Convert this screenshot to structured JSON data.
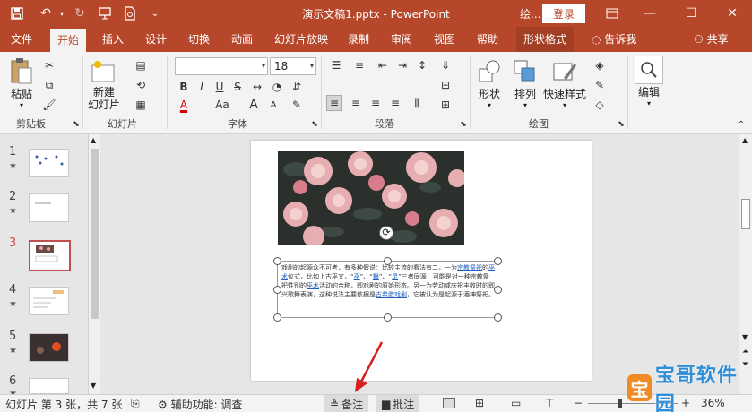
{
  "app": {
    "title": "演示文稿1.pptx  -  PowerPoint",
    "user": "绘...",
    "login": "登录"
  },
  "tabs": [
    {
      "label": "文件"
    },
    {
      "label": "开始"
    },
    {
      "label": "插入"
    },
    {
      "label": "设计"
    },
    {
      "label": "切换"
    },
    {
      "label": "动画"
    },
    {
      "label": "幻灯片放映"
    },
    {
      "label": "录制"
    },
    {
      "label": "审阅"
    },
    {
      "label": "视图"
    },
    {
      "label": "帮助"
    },
    {
      "label": "形状格式"
    },
    {
      "label": "告诉我"
    },
    {
      "label": "共享"
    }
  ],
  "ribbon": {
    "clipboard": {
      "paste": "粘贴",
      "group": "剪贴板"
    },
    "slides": {
      "new_slide": "新建\n幻灯片",
      "group": "幻灯片"
    },
    "font": {
      "name": "",
      "size": "18",
      "group": "字体",
      "bold": "B",
      "italic": "I",
      "underline": "U",
      "strike": "S",
      "font_color": "A",
      "aa": "Aa",
      "grow": "A",
      "shrink": "A"
    },
    "paragraph": {
      "group": "段落"
    },
    "drawing": {
      "shape": "形状",
      "arrange": "排列",
      "quick_styles": "快速样式",
      "group": "绘图"
    },
    "editing": {
      "label": "编辑"
    }
  },
  "thumbnails": [
    {
      "num": "1",
      "star": "★"
    },
    {
      "num": "2",
      "star": "★"
    },
    {
      "num": "3",
      "star": ""
    },
    {
      "num": "4",
      "star": "★"
    },
    {
      "num": "5",
      "star": "★"
    },
    {
      "num": "6",
      "star": "★"
    }
  ],
  "slide": {
    "text_parts": [
      {
        "t": "戏剧的起源众不可考，有多种假说：比较主流的看法有二，一为",
        "link": false
      },
      {
        "t": "宗教祭祀",
        "link": true
      },
      {
        "t": "的",
        "link": false
      },
      {
        "t": "巫术",
        "link": true
      },
      {
        "t": "仪式，比如上古巫文，“",
        "link": false
      },
      {
        "t": "巫",
        "link": true
      },
      {
        "t": "”、“",
        "link": false
      },
      {
        "t": "舞",
        "link": true
      },
      {
        "t": "”、“",
        "link": false
      },
      {
        "t": "灵",
        "link": true
      },
      {
        "t": "”三者同源，可能是对一种宗教祭祀性别的",
        "link": false
      },
      {
        "t": "巫术",
        "link": true
      },
      {
        "t": "活动的合称，即戏剧的原始形态。另一为劳动或庆祝丰收时的即兴歌舞表演，这种说法主要依据是",
        "link": false
      },
      {
        "t": "古希腊戏剧",
        "link": true
      },
      {
        "t": "，它被认为是起源于酒神祭祀。",
        "link": false
      }
    ]
  },
  "status": {
    "slide_info": "幻灯片 第 3 张，共 7 张",
    "accessibility": "辅助功能: 调查",
    "notes": "备注",
    "comments": "批注",
    "zoom": "36%"
  },
  "watermark": {
    "text": "宝哥软件园",
    "logo": "宝"
  }
}
